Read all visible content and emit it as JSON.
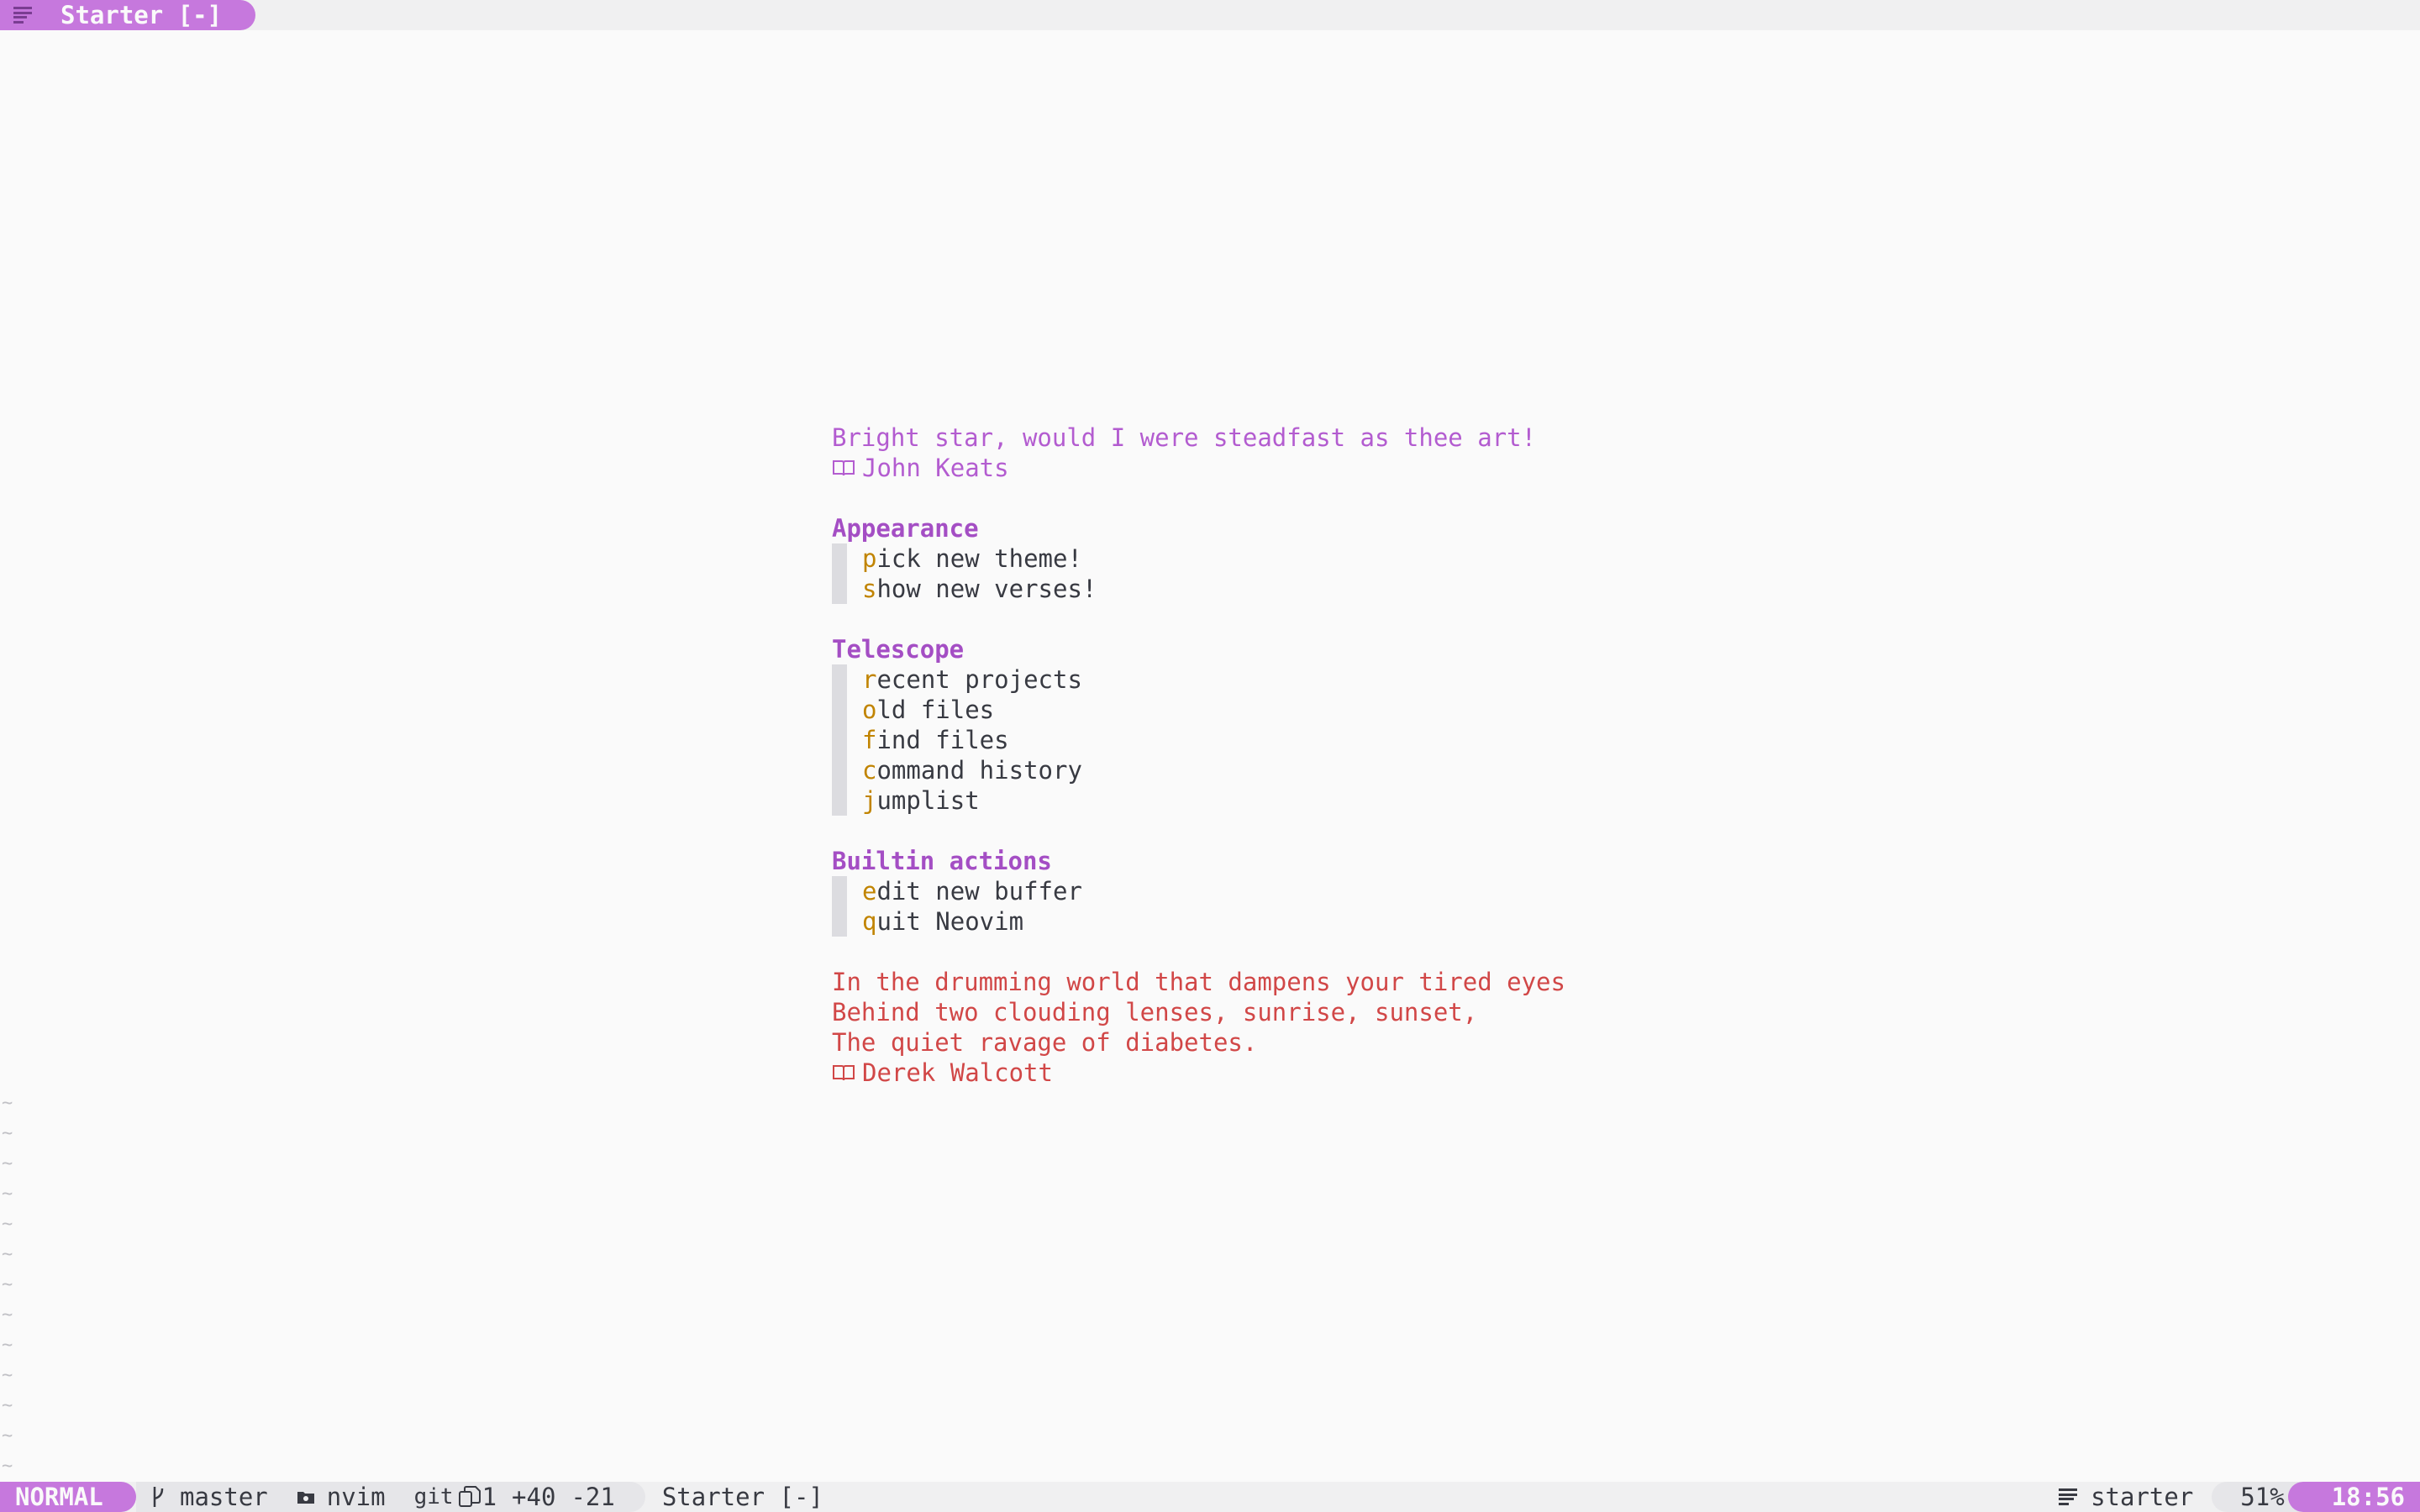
{
  "tabline": {
    "tab_icon": "list-lines-icon",
    "tab_title": "Starter [-]"
  },
  "starter": {
    "header_quote": "Bright star, would I were steadfast as thee art!",
    "header_author": "John Keats",
    "sections": [
      {
        "title": "Appearance",
        "items": [
          {
            "key": "p",
            "rest": "ick new theme!"
          },
          {
            "key": "s",
            "rest": "how new verses!"
          }
        ]
      },
      {
        "title": "Telescope",
        "items": [
          {
            "key": "r",
            "rest": "ecent projects"
          },
          {
            "key": "o",
            "rest": "ld files"
          },
          {
            "key": "f",
            "rest": "ind files"
          },
          {
            "key": "c",
            "rest": "ommand history"
          },
          {
            "key": "j",
            "rest": "umplist"
          }
        ]
      },
      {
        "title": "Builtin actions",
        "items": [
          {
            "key": "e",
            "rest": "dit new buffer"
          },
          {
            "key": "q",
            "rest": "uit Neovim"
          }
        ]
      }
    ],
    "footer_lines": [
      "In the drumming world that dampens your tired eyes",
      "Behind two clouding lenses, sunrise, sunset,",
      "The quiet ravage of diabetes."
    ],
    "footer_author": "Derek Walcott",
    "author_icon": "book-open-icon"
  },
  "tilde_lines": [
    "~",
    "~",
    "~",
    "~",
    "~",
    "~",
    "~",
    "~",
    "~",
    "~",
    "~",
    "~",
    "~"
  ],
  "statusline": {
    "mode": "NORMAL",
    "branch_icon": "git-branch-icon",
    "branch": "master",
    "folder_icon": "folder-icon",
    "cwd": "nvim",
    "git_label": "git",
    "diff_icon": "diff-files-icon",
    "diff_count": "1",
    "added": "+40",
    "removed": "-21",
    "buffer_name": "Starter [-]",
    "filetype_icon": "list-lines-icon",
    "filetype": "starter",
    "percent": "51%",
    "time": "18:56"
  },
  "colors": {
    "accent": "#c678dd",
    "section": "#a44ec4",
    "key": "#c18401",
    "footer": "#d14747",
    "background": "#fafafa"
  }
}
